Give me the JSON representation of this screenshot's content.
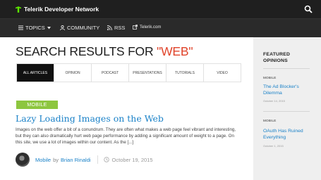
{
  "header": {
    "brand": "Telerik Developer Network",
    "brand_icon": "telerik-logo-icon",
    "search_icon": "search-icon",
    "bar_color": "#1f1f1f"
  },
  "nav": {
    "items": [
      {
        "label": "TOPICS",
        "icon": "menu-icon",
        "suffix_icon": "chevron-down-icon"
      },
      {
        "label": "COMMUNITY",
        "icon": "user-icon"
      },
      {
        "label": "RSS",
        "icon": "rss-icon"
      },
      {
        "label": "Telerik.com",
        "icon": "external-link-icon"
      }
    ]
  },
  "main": {
    "heading_prefix": "SEARCH RESULTS FOR ",
    "heading_query": "\"WEB\"",
    "accent_color": "#e0442b",
    "tabs": [
      "ALL ARTICLES",
      "OPINION",
      "PODCAST",
      "PRESENTATIONS",
      "TUTORIALS",
      "VIDEO"
    ],
    "active_tab": "ALL ARTICLES",
    "article": {
      "category": "MOBILE",
      "category_color": "#8dc63f",
      "title": "Lazy Loading Images on the Web",
      "excerpt": "Images on the web offer a bit of a conundrum. They are often what makes a web page feel vibrant and interesting, but they can also dramatically hurt web page performance by adding a significant amount of weight to a page. On this site, we use a lot of images within our content. As the [...]",
      "category_link": "Mobile",
      "by": "by",
      "author": "Brian Rinaldi",
      "date": "October 19, 2015"
    }
  },
  "sidebar": {
    "heading": "FEATURED OPINIONS",
    "items": [
      {
        "category": "MOBILE",
        "title": "The Ad Blocker's Dilemma",
        "date": "October 14, 2015"
      },
      {
        "category": "MOBILE",
        "title": "OAuth Has Ruined Everything",
        "date": "October 1, 2015"
      }
    ]
  }
}
